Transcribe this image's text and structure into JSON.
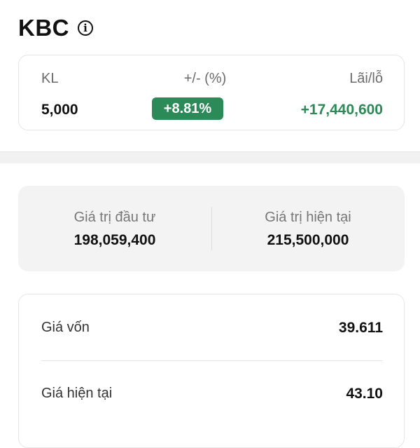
{
  "header": {
    "ticker": "KBC",
    "info_icon": "info-circle-icon"
  },
  "summary": {
    "kl_label": "KL",
    "change_label": "+/- (%)",
    "pl_label": "Lãi/lỗ",
    "kl_value": "5,000",
    "change_value": "+8.81%",
    "pl_value": "+17,440,600"
  },
  "values": {
    "invest_label": "Giá trị đầu tư",
    "invest_value": "198,059,400",
    "current_label": "Giá trị hiện tại",
    "current_value": "215,500,000"
  },
  "prices": {
    "cost_label": "Giá vốn",
    "cost_value": "39.611",
    "current_label": "Giá hiện tại",
    "current_value": "43.10"
  },
  "colors": {
    "positive": "#2b8a57",
    "badge_text": "#ffffff"
  }
}
